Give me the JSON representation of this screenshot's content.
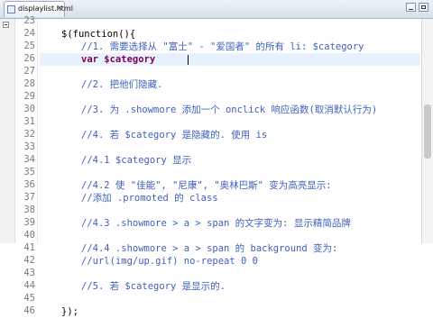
{
  "editor": {
    "tab": {
      "label": "displaylist.html",
      "close": "×"
    },
    "line_numbers": [
      "23",
      "24",
      "25",
      "26",
      "27",
      "28",
      "29",
      "30",
      "31",
      "32",
      "33",
      "34",
      "35",
      "36",
      "37",
      "38",
      "39",
      "40",
      "41",
      "42",
      "43",
      "44",
      "45",
      "46"
    ],
    "lines": [
      {
        "text": "",
        "kind": "norm",
        "indent": 0
      },
      {
        "text": "$(function(){",
        "kind": "norm",
        "indent": 1
      },
      {
        "text": "//1. 需要选择从 \"富士\" - \"爱国者\" 的所有 li: $category",
        "kind": "cmt",
        "indent": 2
      },
      {
        "text": "var $category",
        "kind": "kw",
        "indent": 2
      },
      {
        "text": "",
        "kind": "norm",
        "indent": 0
      },
      {
        "text": "//2. 把他们隐藏.",
        "kind": "cmt",
        "indent": 2
      },
      {
        "text": "",
        "kind": "norm",
        "indent": 0
      },
      {
        "text": "//3. 为 .showmore 添加一个 onclick 响应函数(取消默认行为)",
        "kind": "cmt",
        "indent": 2
      },
      {
        "text": "",
        "kind": "norm",
        "indent": 0
      },
      {
        "text": "//4. 若 $category 是隐藏的. 使用 is",
        "kind": "cmt",
        "indent": 2
      },
      {
        "text": "",
        "kind": "norm",
        "indent": 0
      },
      {
        "text": "//4.1 $category 显示",
        "kind": "cmt",
        "indent": 2
      },
      {
        "text": "",
        "kind": "norm",
        "indent": 0
      },
      {
        "text": "//4.2 使 \"佳能\", \"尼康\", \"奥林巴斯\" 变为高亮显示:",
        "kind": "cmt",
        "indent": 2
      },
      {
        "text": "//添加 .promoted 的 class",
        "kind": "cmt",
        "indent": 2
      },
      {
        "text": "",
        "kind": "norm",
        "indent": 0
      },
      {
        "text": "//4.3 .showmore > a > span 的文字变为: 显示精简品牌",
        "kind": "cmt",
        "indent": 2
      },
      {
        "text": "",
        "kind": "norm",
        "indent": 0
      },
      {
        "text": "//4.4 .showmore > a > span 的 background 变为:",
        "kind": "cmt",
        "indent": 2
      },
      {
        "text": "//url(img/up.gif) no-repeat 0 0",
        "kind": "cmt",
        "indent": 2
      },
      {
        "text": "",
        "kind": "norm",
        "indent": 0
      },
      {
        "text": "//5. 若 $category 是显示的.",
        "kind": "cmt",
        "indent": 2
      },
      {
        "text": "",
        "kind": "norm",
        "indent": 0
      },
      {
        "text": "});",
        "kind": "norm",
        "indent": 1
      }
    ]
  }
}
